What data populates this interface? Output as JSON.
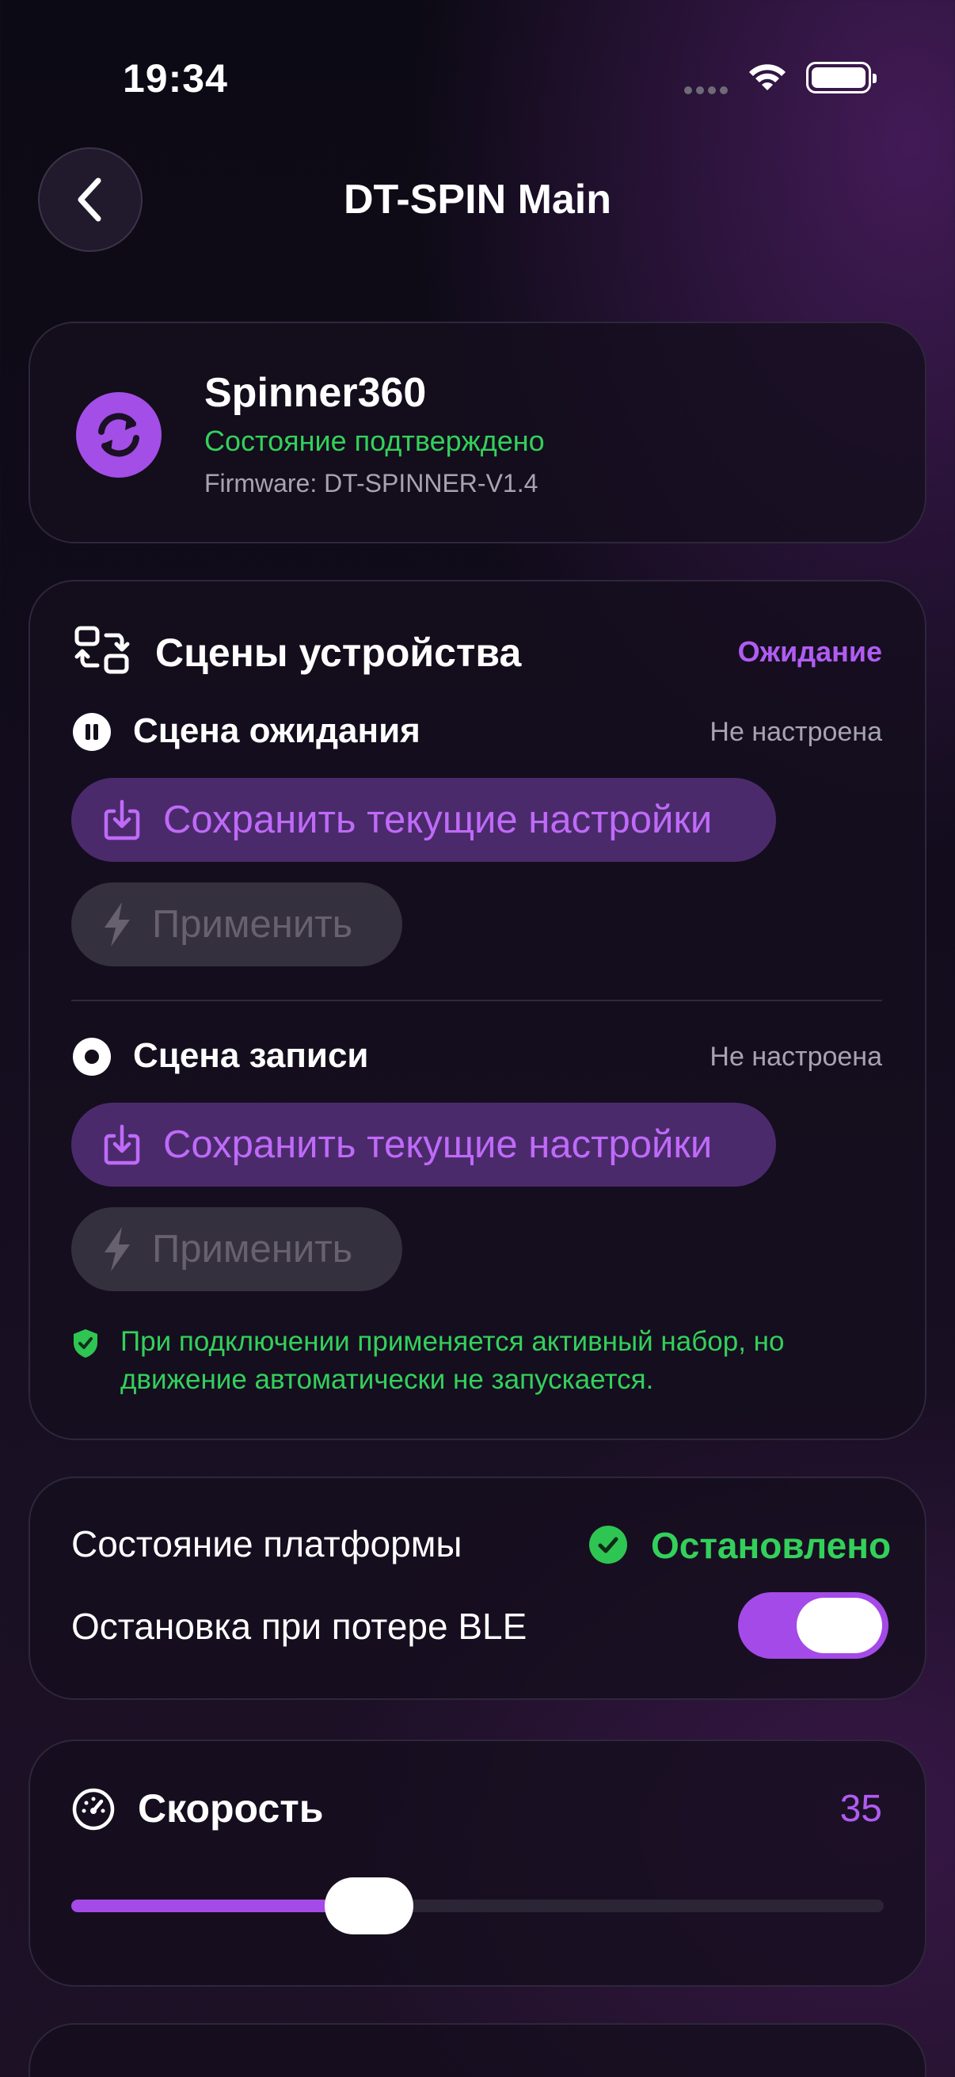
{
  "status_bar": {
    "time": "19:34"
  },
  "header": {
    "title": "DT-SPIN Main"
  },
  "device": {
    "name": "Spinner360",
    "status": "Состояние подтверждено",
    "firmware": "Firmware: DT-SPINNER-V1.4"
  },
  "scenes": {
    "title": "Сцены устройства",
    "state": "Ожидание",
    "items": [
      {
        "title": "Сцена ожидания",
        "status": "Не настроена",
        "save_label": "Сохранить текущие настройки",
        "apply_label": "Применить"
      },
      {
        "title": "Сцена записи",
        "status": "Не настроена",
        "save_label": "Сохранить текущие настройки",
        "apply_label": "Применить"
      }
    ],
    "note": "При подключении применяется активный набор, но движение автоматически не запускается."
  },
  "platform": {
    "state_label": "Состояние платформы",
    "state_value": "Остановлено",
    "ble_stop_label": "Остановка при потере BLE",
    "ble_stop_enabled": true
  },
  "speed": {
    "title": "Скорость",
    "value": "35",
    "slider_fraction": 0.35
  },
  "colors": {
    "accent": "#a44ae8",
    "success": "#33d05b",
    "muted": "#a8a3b1"
  }
}
